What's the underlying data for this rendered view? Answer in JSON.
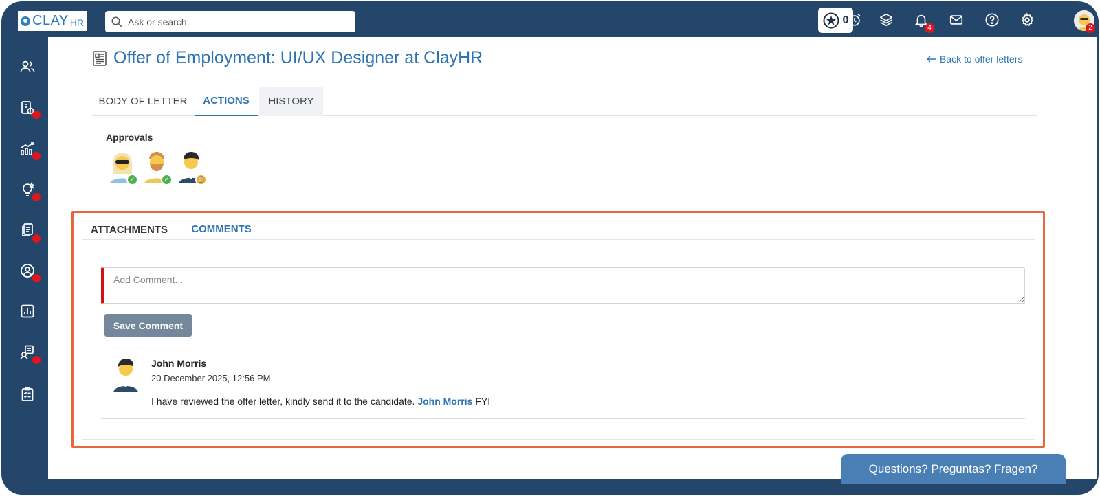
{
  "brand": {
    "logo_main": "CLAY",
    "logo_sub": "HR"
  },
  "search": {
    "placeholder": "Ask or search"
  },
  "header": {
    "star_count": "0",
    "notifications_count": "4",
    "profile_badge_count": "2",
    "icons": [
      "star-icon",
      "alarm-clock-icon",
      "layers-icon",
      "bell-icon",
      "mail-icon",
      "help-icon",
      "gear-icon",
      "avatar"
    ]
  },
  "sidebar": {
    "items": [
      {
        "icon": "people-icon",
        "has_alert": false
      },
      {
        "icon": "payroll-document-icon",
        "has_alert": true
      },
      {
        "icon": "analytics-growth-icon",
        "has_alert": true
      },
      {
        "icon": "lightbulb-icon",
        "has_alert": true
      },
      {
        "icon": "documents-icon",
        "has_alert": true
      },
      {
        "icon": "user-circle-icon",
        "has_alert": true
      },
      {
        "icon": "reports-chart-icon",
        "has_alert": false
      },
      {
        "icon": "onboarding-icon",
        "has_alert": true
      },
      {
        "icon": "checklist-icon",
        "has_alert": false
      }
    ]
  },
  "page": {
    "title": "Offer of Employment: UI/UX Designer at ClayHR",
    "back_link": "Back to offer letters",
    "tabs": [
      {
        "label": "BODY OF LETTER",
        "active": false
      },
      {
        "label": "ACTIONS",
        "active": true
      },
      {
        "label": "HISTORY",
        "active": false
      }
    ]
  },
  "approvals": {
    "label": "Approvals",
    "approvers": [
      {
        "avatar": "woman-sunglasses-avatar",
        "status": "approved"
      },
      {
        "avatar": "bearded-man-avatar",
        "status": "approved"
      },
      {
        "avatar": "man-avatar",
        "status": "pending"
      }
    ]
  },
  "panel": {
    "tabs": [
      {
        "label": "ATTACHMENTS",
        "active": false
      },
      {
        "label": "COMMENTS",
        "active": true
      }
    ],
    "comment_placeholder": "Add Comment...",
    "save_label": "Save Comment",
    "comments": [
      {
        "author": "John Morris",
        "timestamp": "20 December 2025, 12:56 PM",
        "text_before": "I have reviewed the offer letter, kindly send it to the candidate.",
        "mention": "John Morris",
        "text_after": "FYI"
      }
    ]
  },
  "help_widget": {
    "label": "Questions? Preguntas? Fragen?"
  },
  "colors": {
    "frame": "#25466b",
    "accent": "#2e74b5",
    "highlight_border": "#e8663b",
    "alert": "#e3141b",
    "approved": "#4caf50",
    "pending": "#f5a623",
    "save_button": "#74879b"
  }
}
